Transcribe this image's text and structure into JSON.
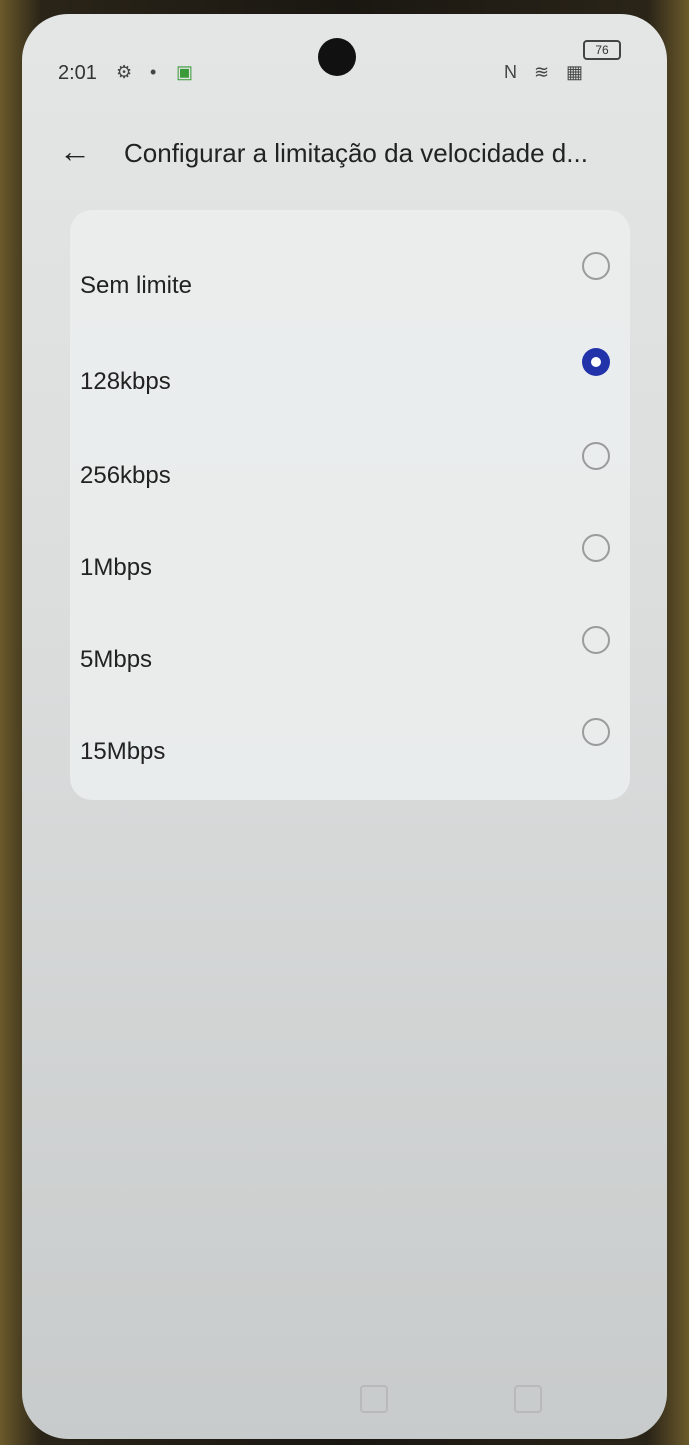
{
  "status_bar": {
    "time": "2:01",
    "battery": "76",
    "icons": [
      "settings-icon",
      "notification-icon",
      "app-icon",
      "nfc-icon",
      "wifi-icon",
      "sim-icon"
    ]
  },
  "header": {
    "back_icon": "back-arrow-icon",
    "title": "Configurar a limitação da velocidade d..."
  },
  "options": [
    {
      "label": "Sem limite",
      "selected": false
    },
    {
      "label": "128kbps",
      "selected": true
    },
    {
      "label": "256kbps",
      "selected": false
    },
    {
      "label": "1Mbps",
      "selected": false
    },
    {
      "label": "5Mbps",
      "selected": false
    },
    {
      "label": "15Mbps",
      "selected": false
    }
  ],
  "colors": {
    "accent": "#2233aa"
  }
}
